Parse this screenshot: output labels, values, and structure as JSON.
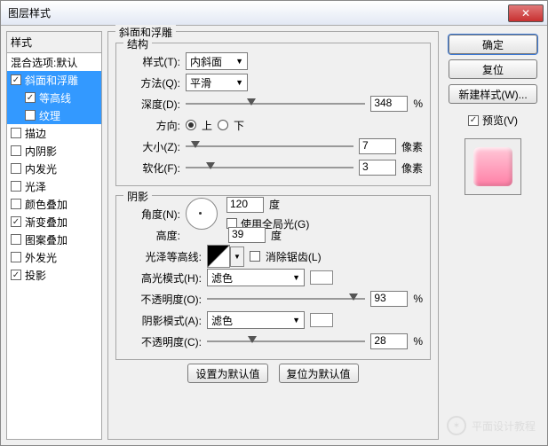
{
  "window": {
    "title": "图层样式"
  },
  "sidebar": {
    "header": "样式",
    "blending": "混合选项:默认",
    "items": [
      {
        "label": "斜面和浮雕",
        "checked": true,
        "selected": true,
        "indent": 0
      },
      {
        "label": "等高线",
        "checked": true,
        "selected": true,
        "indent": 1
      },
      {
        "label": "纹理",
        "checked": false,
        "selected": true,
        "indent": 1
      },
      {
        "label": "描边",
        "checked": false,
        "selected": false,
        "indent": 0
      },
      {
        "label": "内阴影",
        "checked": false,
        "selected": false,
        "indent": 0
      },
      {
        "label": "内发光",
        "checked": false,
        "selected": false,
        "indent": 0
      },
      {
        "label": "光泽",
        "checked": false,
        "selected": false,
        "indent": 0
      },
      {
        "label": "颜色叠加",
        "checked": false,
        "selected": false,
        "indent": 0
      },
      {
        "label": "渐变叠加",
        "checked": true,
        "selected": false,
        "indent": 0
      },
      {
        "label": "图案叠加",
        "checked": false,
        "selected": false,
        "indent": 0
      },
      {
        "label": "外发光",
        "checked": false,
        "selected": false,
        "indent": 0
      },
      {
        "label": "投影",
        "checked": true,
        "selected": false,
        "indent": 0
      }
    ]
  },
  "main": {
    "title": "斜面和浮雕",
    "structure": {
      "legend": "结构",
      "style_lbl": "样式(T):",
      "style_val": "内斜面",
      "tech_lbl": "方法(Q):",
      "tech_val": "平滑",
      "depth_lbl": "深度(D):",
      "depth_val": "348",
      "depth_unit": "%",
      "dir_lbl": "方向:",
      "dir_up": "上",
      "dir_down": "下",
      "size_lbl": "大小(Z):",
      "size_val": "7",
      "size_unit": "像素",
      "soften_lbl": "软化(F):",
      "soften_val": "3",
      "soften_unit": "像素"
    },
    "shading": {
      "legend": "阴影",
      "angle_lbl": "角度(N):",
      "angle_val": "120",
      "angle_unit": "度",
      "global_lbl": "使用全局光(G)",
      "alt_lbl": "高度:",
      "alt_val": "39",
      "alt_unit": "度",
      "gloss_lbl": "光泽等高线:",
      "antialias_lbl": "消除锯齿(L)",
      "hmode_lbl": "高光模式(H):",
      "hmode_val": "滤色",
      "hopac_lbl": "不透明度(O):",
      "hopac_val": "93",
      "hopac_unit": "%",
      "smode_lbl": "阴影模式(A):",
      "smode_val": "滤色",
      "sopac_lbl": "不透明度(C):",
      "sopac_val": "28",
      "sopac_unit": "%"
    },
    "btns": {
      "default": "设置为默认值",
      "reset": "复位为默认值"
    }
  },
  "right": {
    "ok": "确定",
    "cancel": "复位",
    "newstyle": "新建样式(W)...",
    "preview_lbl": "预览(V)"
  },
  "watermark": "平面设计教程"
}
